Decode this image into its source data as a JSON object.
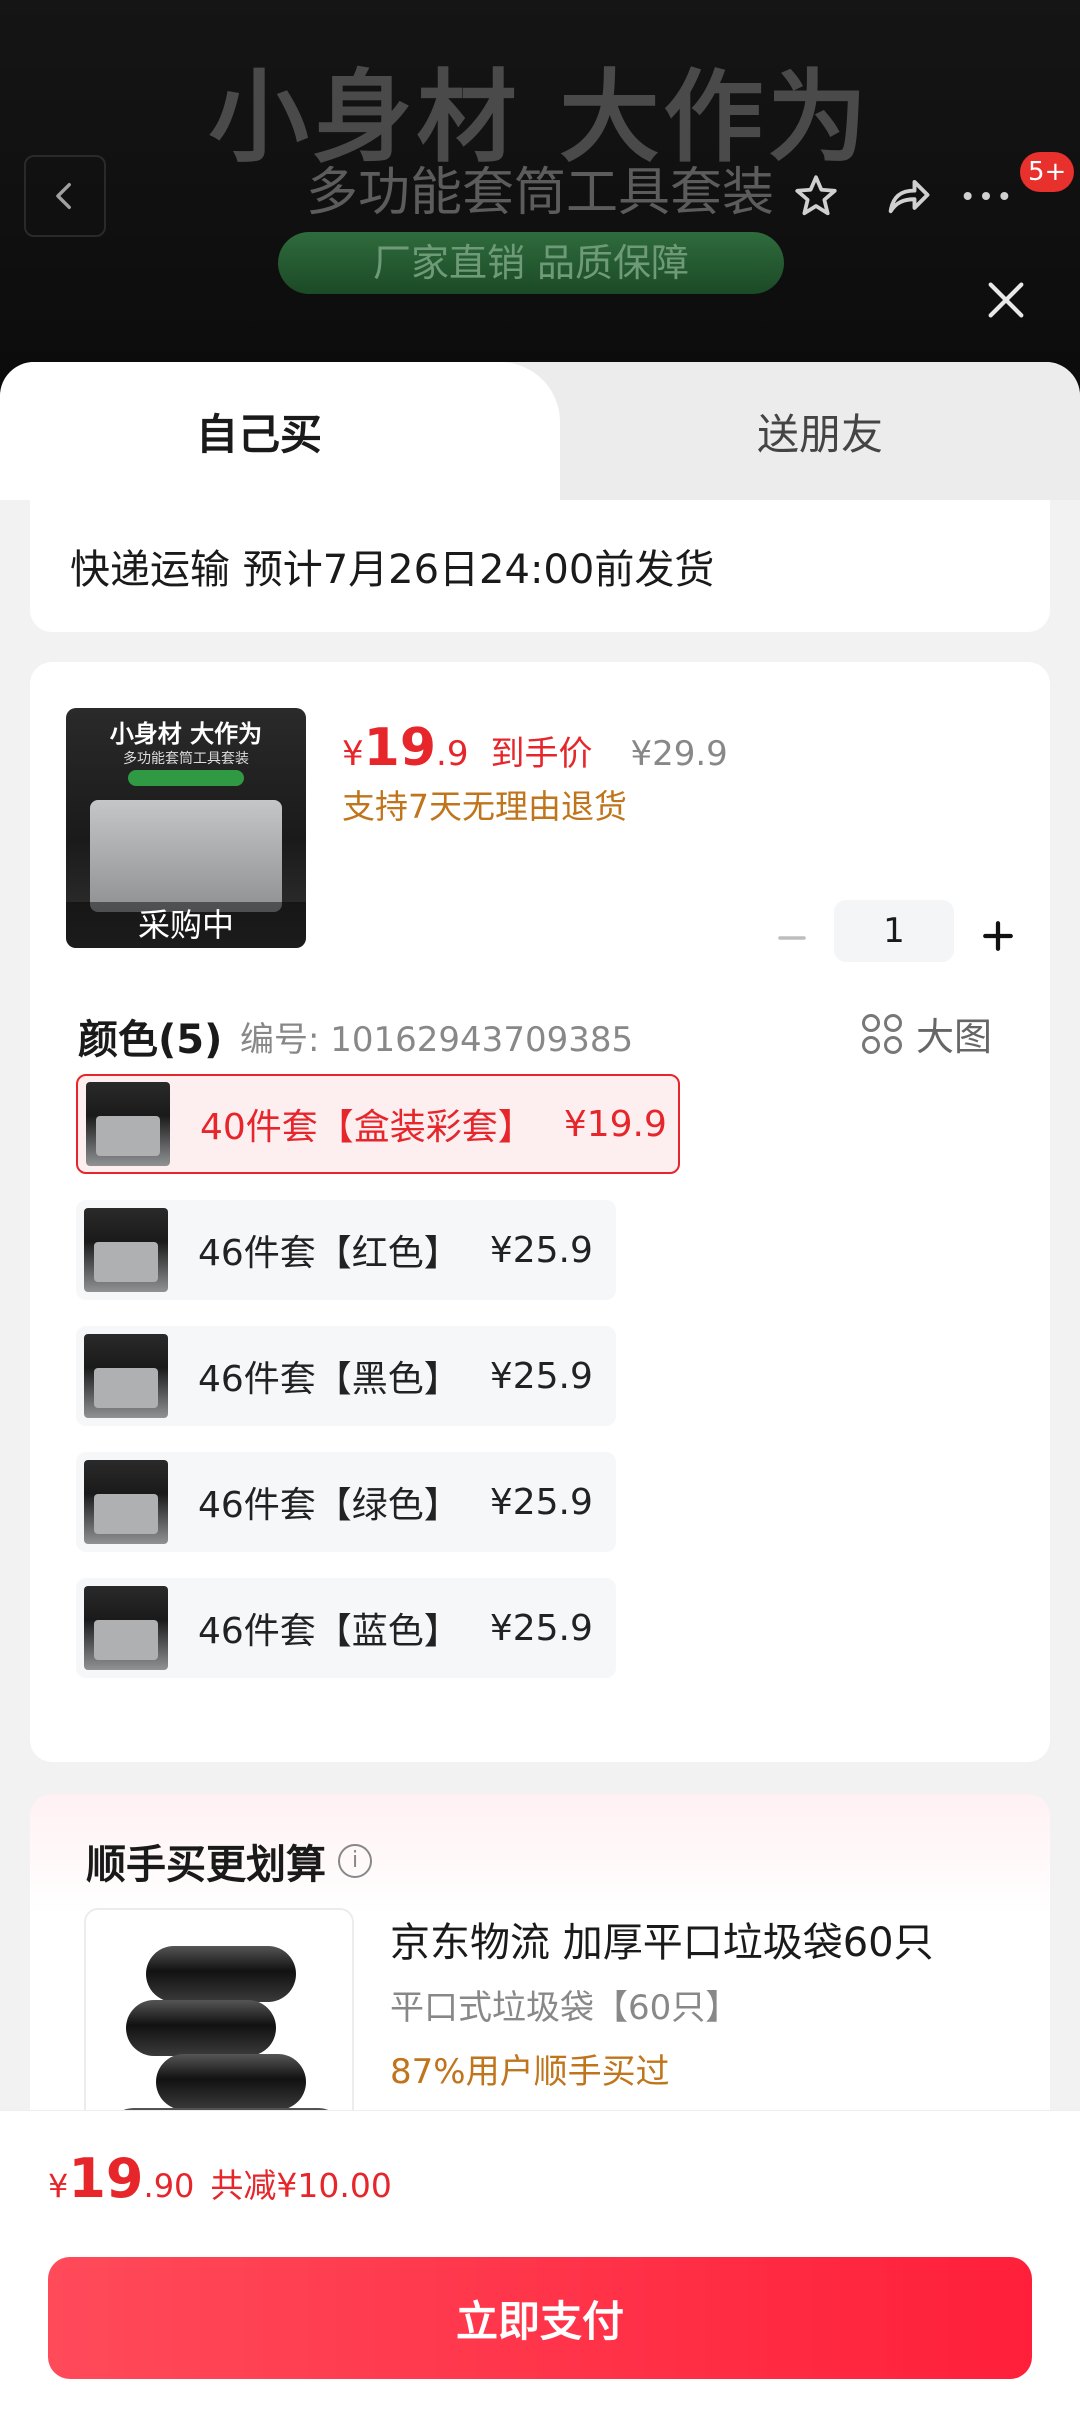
{
  "banner": {
    "headline": "小身材 大作为",
    "subline": "多功能套筒工具套装",
    "pill": "厂家直销 品质保障",
    "badge": "5+"
  },
  "icons": {
    "back": "chevron-left-icon",
    "favorite": "star-icon",
    "share": "share-icon",
    "more": "more-dots-icon",
    "close": "close-icon",
    "big_picture": "grid-icon",
    "info": "info-icon"
  },
  "tabs": {
    "self": "自己买",
    "friend": "送朋友"
  },
  "shipping": {
    "text": "快递运输 预计7月26日24:00前发货"
  },
  "product": {
    "thumb_line1": "小身材 大作为",
    "thumb_line2": "多功能套筒工具套装",
    "thumb_status": "采购中",
    "price_yen": "¥",
    "price_int": "19",
    "price_dec": ".9",
    "price_tag": "到手价",
    "original_price": "¥29.9",
    "return_policy": "支持7天无理由退货",
    "quantity": "1",
    "colors": {
      "heading": "颜色(5)",
      "sku": "编号: 10162943709385",
      "big_picture": "大图",
      "options": [
        {
          "name": "40件套【盒装彩套】",
          "price": "¥19.9",
          "selected": true
        },
        {
          "name": "46件套【红色】",
          "price": "¥25.9",
          "selected": false
        },
        {
          "name": "46件套【黑色】",
          "price": "¥25.9",
          "selected": false
        },
        {
          "name": "46件套【绿色】",
          "price": "¥25.9",
          "selected": false
        },
        {
          "name": "46件套【蓝色】",
          "price": "¥25.9",
          "selected": false
        }
      ]
    }
  },
  "addon": {
    "title": "顺手买更划算",
    "item_name": "京东物流 加厚平口垃圾袋60只",
    "item_spec": "平口式垃圾袋【60只】",
    "item_popularity": "87%用户顺手买过"
  },
  "footer": {
    "total_yen": "¥",
    "total_int": "19",
    "total_dec": ".90",
    "discount": "共减¥10.00",
    "pay_button": "立即支付"
  },
  "colors": {
    "accent": "#e6262a",
    "pay_button": "#ff1f3a",
    "orange_text": "#c0741b"
  }
}
